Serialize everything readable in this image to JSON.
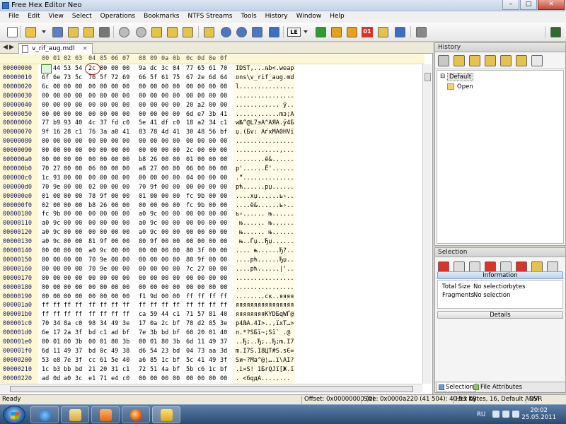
{
  "window": {
    "title": "Free Hex Editor Neo"
  },
  "menu": [
    "File",
    "Edit",
    "View",
    "Select",
    "Operations",
    "Bookmarks",
    "NTFS Streams",
    "Tools",
    "History",
    "Window",
    "Help"
  ],
  "toolbar": {
    "icons": [
      "new-file-icon",
      "open-folder-icon",
      "open-dropdown-icon",
      "save-icon",
      "save-as-icon",
      "save-all-icon",
      "print-icon",
      "undo-icon",
      "redo-icon",
      "edit-icon",
      "copy-icon",
      "paste-icon",
      "goto-icon",
      "find-icon",
      "find-next-icon",
      "replace-icon",
      "highlight-icon",
      "encoding-le-icon",
      "encoding-dropdown-icon",
      "green-arrow-icon",
      "insert-icon",
      "fill-icon",
      "bits-icon",
      "pattern-icon",
      "tool-icon",
      "grid-icon",
      "settings-wrench-icon"
    ],
    "endian_label": "LE",
    "bits_label": "01"
  },
  "editor": {
    "tab_label": "v_rif_aug.mdl",
    "close_glyph": "×",
    "nav_left": "◀",
    "nav_right": "▶",
    "column_headers": [
      "00",
      "01",
      "02",
      "03",
      "04",
      "05",
      "06",
      "07",
      "08",
      "09",
      "0a",
      "0b",
      "0c",
      "0d",
      "0e",
      "0f"
    ],
    "rows": [
      {
        "off": "00000000",
        "hex": [
          "49",
          "44",
          "53",
          "54",
          "2c",
          "00",
          "00",
          "00",
          "9a",
          "dc",
          "3c",
          "04",
          "77",
          "65",
          "61",
          "70"
        ],
        "ascii": "IDST,...љb<.weap"
      },
      {
        "off": "00000010",
        "hex": [
          "6f",
          "6e",
          "73",
          "5c",
          "76",
          "5f",
          "72",
          "69",
          "66",
          "5f",
          "61",
          "75",
          "67",
          "2e",
          "6d",
          "64"
        ],
        "ascii": "ons\\v_rif_aug.md"
      },
      {
        "off": "00000020",
        "hex": [
          "6c",
          "00",
          "00",
          "00",
          "00",
          "00",
          "00",
          "00",
          "00",
          "00",
          "00",
          "00",
          "00",
          "00",
          "00",
          "00"
        ],
        "ascii": "l..............."
      },
      {
        "off": "00000030",
        "hex": [
          "00",
          "00",
          "00",
          "00",
          "00",
          "00",
          "00",
          "00",
          "00",
          "00",
          "00",
          "00",
          "00",
          "00",
          "00",
          "00"
        ],
        "ascii": "................"
      },
      {
        "off": "00000040",
        "hex": [
          "00",
          "00",
          "00",
          "00",
          "00",
          "00",
          "00",
          "00",
          "00",
          "00",
          "00",
          "00",
          "20",
          "a2",
          "00",
          "00"
        ],
        "ascii": "............ ў.."
      },
      {
        "off": "00000050",
        "hex": [
          "00",
          "00",
          "00",
          "00",
          "00",
          "00",
          "00",
          "00",
          "00",
          "00",
          "00",
          "00",
          "6d",
          "e7",
          "3b",
          "41"
        ],
        "ascii": "............mз;A"
      },
      {
        "off": "00000060",
        "hex": [
          "77",
          "b9",
          "93",
          "40",
          "4c",
          "37",
          "fd",
          "c0",
          "5e",
          "41",
          "df",
          "c0",
          "18",
          "a2",
          "34",
          "c1"
        ],
        "ascii": "w№“@L7эА^AЯА.ў4Б"
      },
      {
        "off": "00000070",
        "hex": [
          "9f",
          "16",
          "28",
          "c1",
          "76",
          "3a",
          "a0",
          "41",
          "83",
          "78",
          "4d",
          "41",
          "30",
          "48",
          "56",
          "bf"
        ],
        "ascii": "џ.(Бv: AѓxMA0HVї"
      },
      {
        "off": "00000080",
        "hex": [
          "00",
          "00",
          "00",
          "00",
          "00",
          "00",
          "00",
          "00",
          "00",
          "00",
          "00",
          "00",
          "00",
          "00",
          "00",
          "00"
        ],
        "ascii": "................"
      },
      {
        "off": "00000090",
        "hex": [
          "00",
          "00",
          "00",
          "00",
          "00",
          "00",
          "00",
          "00",
          "00",
          "00",
          "00",
          "00",
          "2c",
          "00",
          "00",
          "00"
        ],
        "ascii": "............,..."
      },
      {
        "off": "000000a0",
        "hex": [
          "00",
          "00",
          "00",
          "00",
          "00",
          "00",
          "00",
          "00",
          "b8",
          "26",
          "00",
          "00",
          "01",
          "00",
          "00",
          "00"
        ],
        "ascii": "........ё&......"
      },
      {
        "off": "000000b0",
        "hex": [
          "70",
          "27",
          "00",
          "00",
          "06",
          "00",
          "00",
          "00",
          "a8",
          "27",
          "00",
          "00",
          "06",
          "00",
          "00",
          "00"
        ],
        "ascii": "p'......Ё'......"
      },
      {
        "off": "000000c0",
        "hex": [
          "1c",
          "93",
          "00",
          "00",
          "00",
          "00",
          "00",
          "00",
          "00",
          "00",
          "00",
          "00",
          "04",
          "00",
          "00",
          "00"
        ],
        "ascii": ".“.............."
      },
      {
        "off": "000000d0",
        "hex": [
          "70",
          "9e",
          "00",
          "00",
          "02",
          "00",
          "00",
          "00",
          "70",
          "9f",
          "00",
          "00",
          "00",
          "00",
          "00",
          "00"
        ],
        "ascii": "pћ......pџ......"
      },
      {
        "off": "000000e0",
        "hex": [
          "01",
          "00",
          "00",
          "00",
          "78",
          "9f",
          "00",
          "00",
          "01",
          "00",
          "00",
          "00",
          "fc",
          "9b",
          "00",
          "00"
        ],
        "ascii": "....xџ......ь›.."
      },
      {
        "off": "000000f0",
        "hex": [
          "02",
          "00",
          "00",
          "00",
          "b8",
          "26",
          "00",
          "00",
          "00",
          "00",
          "00",
          "00",
          "fc",
          "9b",
          "00",
          "00"
        ],
        "ascii": "....ё&......ь›.."
      },
      {
        "off": "00000100",
        "hex": [
          "fc",
          "9b",
          "00",
          "00",
          "00",
          "00",
          "00",
          "00",
          "a0",
          "9c",
          "00",
          "00",
          "00",
          "00",
          "00",
          "00"
        ],
        "ascii": "ь›...... њ......"
      },
      {
        "off": "00000110",
        "hex": [
          "a0",
          "9c",
          "00",
          "00",
          "00",
          "00",
          "00",
          "00",
          "a0",
          "9c",
          "00",
          "00",
          "00",
          "00",
          "00",
          "00"
        ],
        "ascii": " њ...... њ......"
      },
      {
        "off": "00000120",
        "hex": [
          "a0",
          "9c",
          "00",
          "00",
          "00",
          "00",
          "00",
          "00",
          "a0",
          "9c",
          "00",
          "00",
          "00",
          "00",
          "00",
          "00"
        ],
        "ascii": " њ...... њ......"
      },
      {
        "off": "00000130",
        "hex": [
          "a0",
          "9c",
          "00",
          "00",
          "81",
          "9f",
          "00",
          "00",
          "80",
          "9f",
          "00",
          "00",
          "00",
          "00",
          "00",
          "00"
        ],
        "ascii": " њ..Ѓџ..Ђџ......"
      },
      {
        "off": "00000140",
        "hex": [
          "00",
          "00",
          "00",
          "00",
          "a0",
          "9c",
          "00",
          "00",
          "00",
          "00",
          "00",
          "00",
          "80",
          "3f",
          "00",
          "00"
        ],
        "ascii": ".... њ......Ђ?.."
      },
      {
        "off": "00000150",
        "hex": [
          "00",
          "00",
          "00",
          "00",
          "70",
          "9e",
          "00",
          "00",
          "00",
          "00",
          "00",
          "00",
          "80",
          "9f",
          "00",
          "00"
        ],
        "ascii": "....pћ......Ђџ.."
      },
      {
        "off": "00000160",
        "hex": [
          "00",
          "00",
          "00",
          "00",
          "70",
          "9e",
          "00",
          "00",
          "00",
          "00",
          "00",
          "00",
          "7c",
          "27",
          "00",
          "00"
        ],
        "ascii": "....pћ......|'.."
      },
      {
        "off": "00000170",
        "hex": [
          "00",
          "00",
          "00",
          "00",
          "00",
          "00",
          "00",
          "00",
          "00",
          "00",
          "00",
          "00",
          "00",
          "00",
          "00",
          "00"
        ],
        "ascii": "................"
      },
      {
        "off": "00000180",
        "hex": [
          "00",
          "00",
          "00",
          "00",
          "00",
          "00",
          "00",
          "00",
          "00",
          "00",
          "00",
          "00",
          "00",
          "00",
          "00",
          "00"
        ],
        "ascii": "................"
      },
      {
        "off": "00000190",
        "hex": [
          "00",
          "00",
          "00",
          "00",
          "00",
          "00",
          "00",
          "00",
          "f1",
          "9d",
          "00",
          "00",
          "ff",
          "ff",
          "ff",
          "ff"
        ],
        "ascii": "........ск..яяяя"
      },
      {
        "off": "000001a0",
        "hex": [
          "ff",
          "ff",
          "ff",
          "ff",
          "ff",
          "ff",
          "ff",
          "ff",
          "ff",
          "ff",
          "ff",
          "ff",
          "ff",
          "ff",
          "ff",
          "ff"
        ],
        "ascii": "яяяяяяяяяяяяяяяя"
      },
      {
        "off": "000001b0",
        "hex": [
          "ff",
          "ff",
          "ff",
          "ff",
          "ff",
          "ff",
          "ff",
          "ff",
          "ca",
          "59",
          "44",
          "c1",
          "71",
          "57",
          "81",
          "40"
        ],
        "ascii": "яяяяяяяяКYDБqWЃ@"
      },
      {
        "off": "000001c0",
        "hex": [
          "70",
          "34",
          "8a",
          "c0",
          "98",
          "34",
          "49",
          "3e",
          "17",
          "0a",
          "2c",
          "bf",
          "78",
          "d2",
          "85",
          "3e"
        ],
        "ascii": "p4ЉА.4I>..,їxТ…>"
      },
      {
        "off": "000001d0",
        "hex": [
          "6e",
          "17",
          "2a",
          "3f",
          "bd",
          "c1",
          "ad",
          "bf",
          "7e",
          "3b",
          "bd",
          "bf",
          "60",
          "20",
          "01",
          "40"
        ],
        "ascii": "n.*?ЅБ­ї~;Ѕї` .@"
      },
      {
        "off": "000001e0",
        "hex": [
          "00",
          "01",
          "80",
          "3b",
          "00",
          "01",
          "80",
          "3b",
          "00",
          "01",
          "80",
          "3b",
          "6d",
          "11",
          "49",
          "37"
        ],
        "ascii": "..Ђ;..Ђ;..Ђ;m.I7"
      },
      {
        "off": "000001f0",
        "hex": [
          "6d",
          "11",
          "49",
          "37",
          "bd",
          "0c",
          "49",
          "38",
          "d6",
          "54",
          "23",
          "bd",
          "04",
          "73",
          "aa",
          "3d"
        ],
        "ascii": "m.I7Ѕ.I8ЦT#Ѕ.sЄ="
      },
      {
        "off": "00000200",
        "hex": [
          "53",
          "e8",
          "7e",
          "3f",
          "cc",
          "61",
          "5e",
          "40",
          "a6",
          "85",
          "1c",
          "bf",
          "5c",
          "41",
          "49",
          "3f"
        ],
        "ascii": "Sи~?Мa^@¦….ї\\AI?"
      },
      {
        "off": "00000210",
        "hex": [
          "1c",
          "b3",
          "bb",
          "bd",
          "21",
          "20",
          "31",
          "c1",
          "72",
          "51",
          "4a",
          "bf",
          "5b",
          "c6",
          "1c",
          "bf"
        ],
        "ascii": ".і»Ѕ! 1БrQJї[Ж.ї"
      },
      {
        "off": "00000220",
        "hex": [
          "ad",
          "0d",
          "a0",
          "3c",
          "e1",
          "71",
          "e4",
          "c0",
          "00",
          "00",
          "00",
          "00",
          "00",
          "00",
          "00",
          "00"
        ],
        "ascii": "­. <бqдА........"
      },
      {
        "off": "00000230",
        "hex": [
          "00",
          "00",
          "00",
          "00",
          "00",
          "00",
          "00",
          "00",
          "00",
          "00",
          "00",
          "00",
          "00",
          "00",
          "00",
          "00"
        ],
        "ascii": "................"
      }
    ]
  },
  "history": {
    "title": "History",
    "tools": [
      "history-tool-1-icon",
      "history-tool-2-icon",
      "history-tool-3-icon",
      "history-tool-4-icon",
      "history-tool-5-icon",
      "history-tool-6-icon",
      "history-tool-7-icon"
    ],
    "root": "Default",
    "child": "Open"
  },
  "selection": {
    "title": "Selection",
    "tools": [
      "sel-tool-1-icon",
      "sel-tool-2-icon",
      "sel-tool-3-icon",
      "sel-tool-4-icon",
      "sel-tool-5-icon",
      "sel-tool-6-icon",
      "sel-tool-7-icon",
      "sel-tool-8-icon"
    ],
    "info_label": "Information",
    "total_size_label": "Total Size",
    "total_size_value": "No selection",
    "total_size_unit": "bytes",
    "fragments_label": "Fragments",
    "fragments_value": "No selection",
    "details_label": "Details",
    "tab_selection": "Selection",
    "tab_file_attributes": "File Attributes"
  },
  "status": {
    "ready": "Ready",
    "offset": "Offset: 0x00000000 (0)",
    "size": "Size: 0x0000a220 (41 504): 40,53 KB",
    "mode": "Hex bytes, 16, Default ANSI",
    "ovr": "OVR"
  },
  "taskbar": {
    "apps": [
      "ie-icon",
      "explorer-icon",
      "media-player-icon",
      "firefox-icon",
      "hex-editor-icon"
    ],
    "lang": "RU",
    "time": "20:02",
    "date": "25.05.2011"
  },
  "colors": {
    "accent": "#3a6fc4",
    "cursor_green": "#2a8a2a",
    "annotation_red": "#d01818"
  }
}
